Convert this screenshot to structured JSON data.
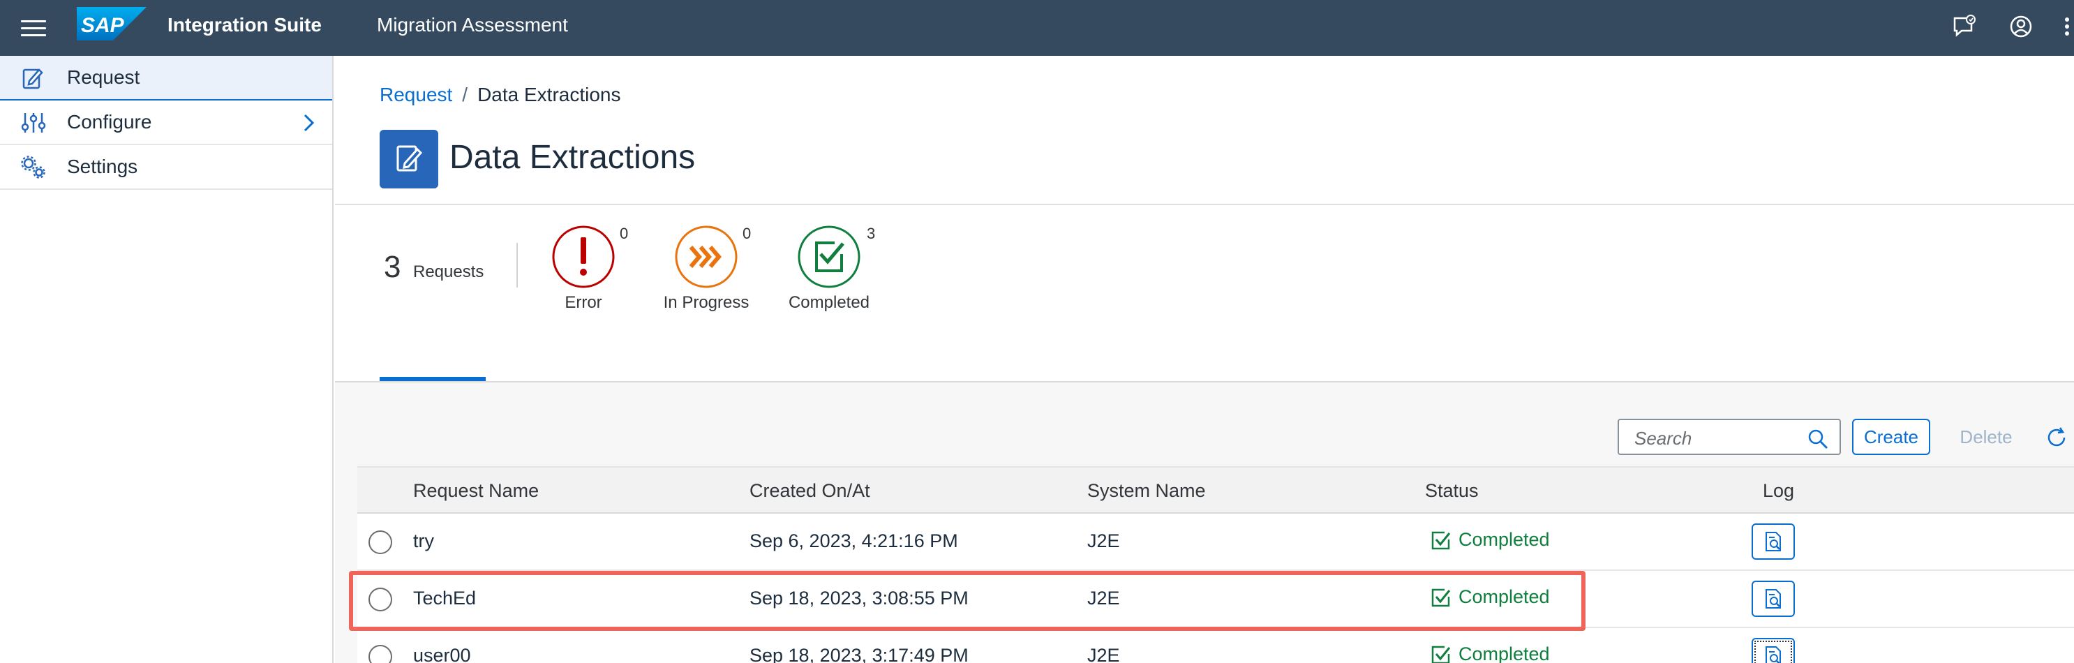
{
  "shell": {
    "brand": "SAP",
    "app_title": "Integration Suite",
    "subtitle": "Migration Assessment",
    "icons": [
      "menu-icon",
      "feedback-icon",
      "user-icon",
      "overflow-icon"
    ]
  },
  "sidenav": {
    "items": [
      {
        "label": "Request",
        "icon": "request-icon",
        "selected": true
      },
      {
        "label": "Configure",
        "icon": "sliders-icon",
        "has_children": true
      },
      {
        "label": "Settings",
        "icon": "gears-icon"
      }
    ]
  },
  "breadcrumb": {
    "link": "Request",
    "separator": "/",
    "current": "Data Extractions"
  },
  "page": {
    "title": "Data Extractions"
  },
  "tabs": {
    "all": {
      "count": "3",
      "label": "Requests"
    },
    "error": {
      "count": "0",
      "label": "Error",
      "color": "#bb0000"
    },
    "in_progress": {
      "count": "0",
      "label": "In Progress",
      "color": "#e9730c"
    },
    "completed": {
      "count": "3",
      "label": "Completed",
      "color": "#107e3e"
    }
  },
  "toolbar": {
    "search_placeholder": "Search",
    "create": "Create",
    "delete": "Delete"
  },
  "table": {
    "headers": {
      "name": "Request Name",
      "created": "Created On/At",
      "system": "System Name",
      "status": "Status",
      "log": "Log"
    },
    "rows": [
      {
        "name": "try",
        "created": "Sep 6, 2023, 4:21:16 PM",
        "system": "J2E",
        "status": "Completed"
      },
      {
        "name": "TechEd",
        "created": "Sep 18, 2023, 3:08:55 PM",
        "system": "J2E",
        "status": "Completed"
      },
      {
        "name": "user00",
        "created": "Sep 18, 2023, 3:17:49 PM",
        "system": "J2E",
        "status": "Completed"
      }
    ]
  },
  "colors": {
    "shell": "#354a5f",
    "accent": "#0a6ed1",
    "success": "#107e3e",
    "highlight": "#f0655a"
  }
}
